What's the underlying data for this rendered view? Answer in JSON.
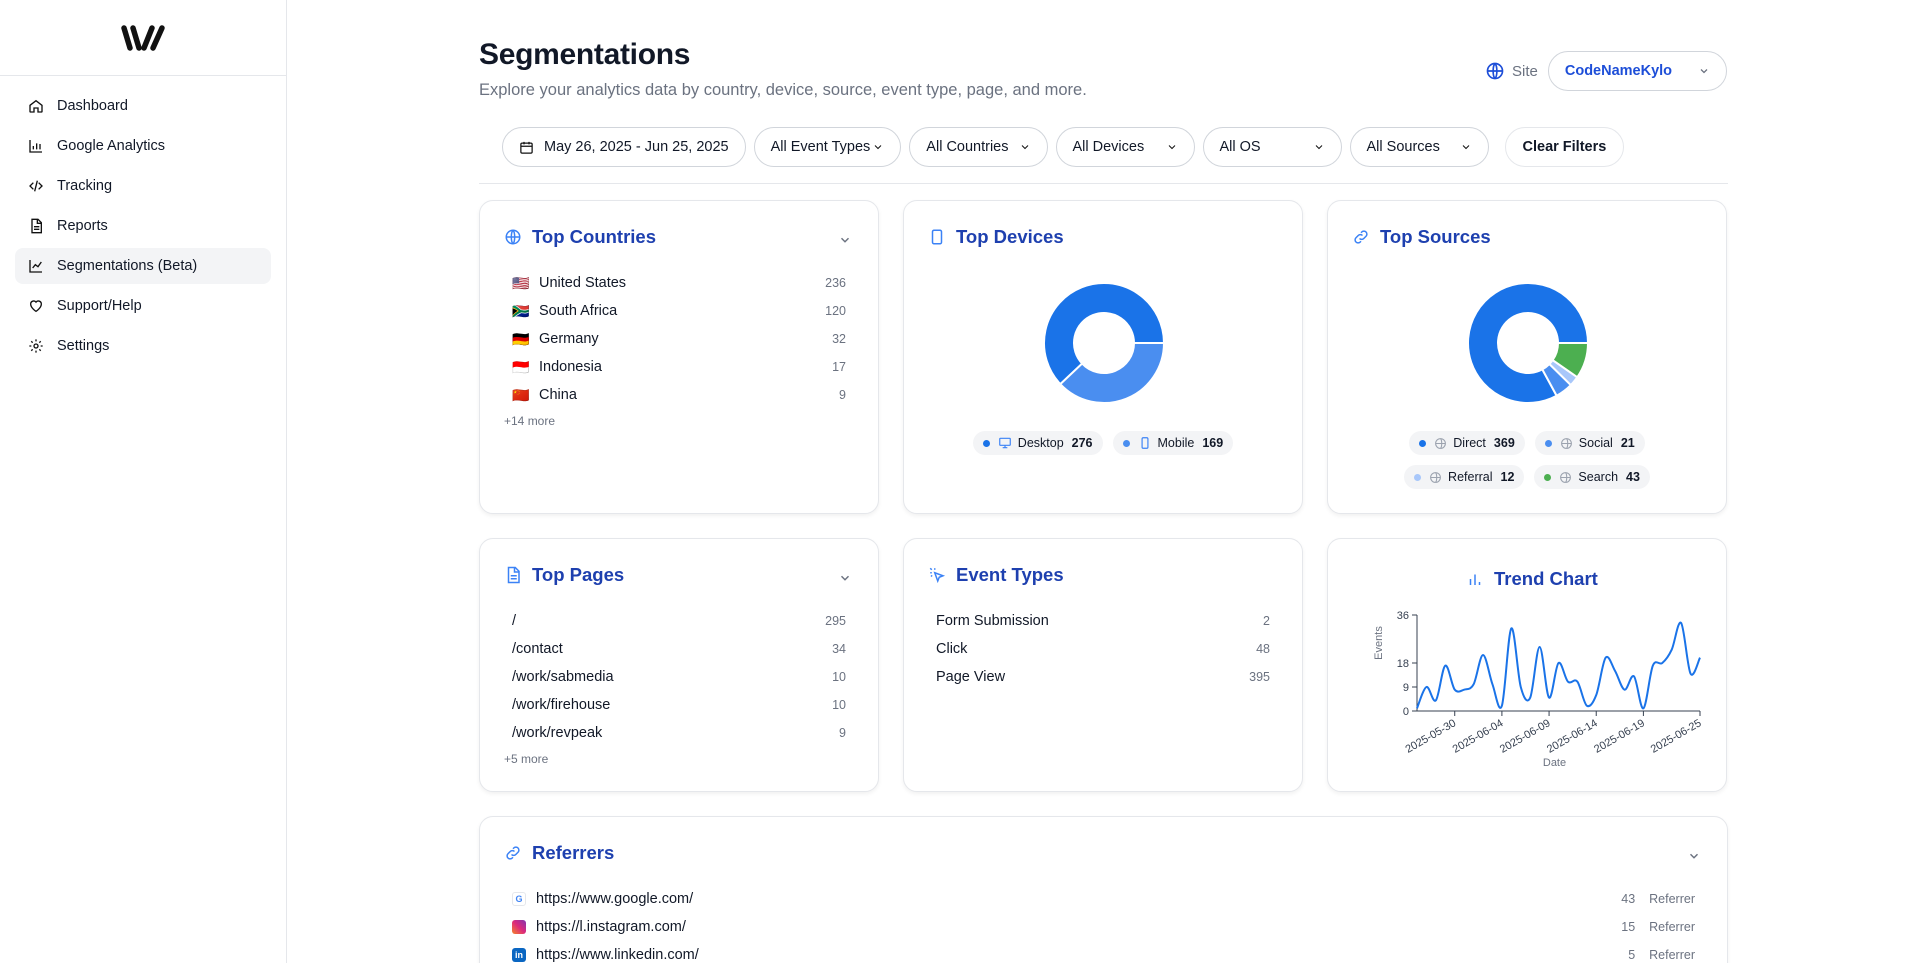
{
  "sidebar": {
    "items": [
      {
        "label": "Dashboard",
        "icon": "home-icon"
      },
      {
        "label": "Google Analytics",
        "icon": "bar-chart-icon"
      },
      {
        "label": "Tracking",
        "icon": "code-icon"
      },
      {
        "label": "Reports",
        "icon": "document-icon"
      },
      {
        "label": "Segmentations (Beta)",
        "icon": "line-chart-icon",
        "active": true
      },
      {
        "label": "Support/Help",
        "icon": "heart-icon"
      },
      {
        "label": "Settings",
        "icon": "gear-icon"
      }
    ]
  },
  "header": {
    "title": "Segmentations",
    "subtitle": "Explore your analytics data by country, device, source, event type, page, and more.",
    "site_label": "Site",
    "site_value": "CodeNameKylo"
  },
  "filters": {
    "date_range": "May 26, 2025 - Jun 25, 2025",
    "event_types": "All Event Types",
    "countries": "All Countries",
    "devices": "All Devices",
    "os": "All OS",
    "sources": "All Sources",
    "clear": "Clear Filters"
  },
  "top_countries": {
    "title": "Top Countries",
    "rows": [
      {
        "flag": "🇺🇸",
        "name": "United States",
        "count": "236"
      },
      {
        "flag": "🇿🇦",
        "name": "South Africa",
        "count": "120"
      },
      {
        "flag": "🇩🇪",
        "name": "Germany",
        "count": "32"
      },
      {
        "flag": "🇮🇩",
        "name": "Indonesia",
        "count": "17"
      },
      {
        "flag": "🇨🇳",
        "name": "China",
        "count": "9"
      }
    ],
    "more": "+14 more"
  },
  "top_devices": {
    "title": "Top Devices",
    "items": [
      {
        "label": "Desktop",
        "value": "276",
        "color": "#1a73e8"
      },
      {
        "label": "Mobile",
        "value": "169",
        "color": "#4a8ef0"
      }
    ]
  },
  "top_sources": {
    "title": "Top Sources",
    "items": [
      {
        "label": "Direct",
        "value": "369",
        "color": "#1a73e8"
      },
      {
        "label": "Social",
        "value": "21",
        "color": "#4a8ef0"
      },
      {
        "label": "Referral",
        "value": "12",
        "color": "#a8c7fa"
      },
      {
        "label": "Search",
        "value": "43",
        "color": "#4caf50"
      }
    ]
  },
  "top_pages": {
    "title": "Top Pages",
    "rows": [
      {
        "path": "/",
        "count": "295"
      },
      {
        "path": "/contact",
        "count": "34"
      },
      {
        "path": "/work/sabmedia",
        "count": "10"
      },
      {
        "path": "/work/firehouse",
        "count": "10"
      },
      {
        "path": "/work/revpeak",
        "count": "9"
      }
    ],
    "more": "+5 more"
  },
  "event_types": {
    "title": "Event Types",
    "rows": [
      {
        "name": "Form Submission",
        "count": "2"
      },
      {
        "name": "Click",
        "count": "48"
      },
      {
        "name": "Page View",
        "count": "395"
      }
    ]
  },
  "trend": {
    "title": "Trend Chart"
  },
  "chart_data": {
    "type": "line",
    "title": "",
    "xlabel": "Date",
    "ylabel": "Events",
    "ylim": [
      0,
      36
    ],
    "yticks": [
      "0",
      "9",
      "18",
      "36"
    ],
    "xticks": [
      "2025-05-30",
      "2025-06-04",
      "2025-06-09",
      "2025-06-14",
      "2025-06-19",
      "2025-06-25"
    ],
    "x": [
      "2025-05-26",
      "2025-05-27",
      "2025-05-28",
      "2025-05-29",
      "2025-05-30",
      "2025-05-31",
      "2025-06-01",
      "2025-06-02",
      "2025-06-03",
      "2025-06-04",
      "2025-06-05",
      "2025-06-06",
      "2025-06-07",
      "2025-06-08",
      "2025-06-09",
      "2025-06-10",
      "2025-06-11",
      "2025-06-12",
      "2025-06-13",
      "2025-06-14",
      "2025-06-15",
      "2025-06-16",
      "2025-06-17",
      "2025-06-18",
      "2025-06-19",
      "2025-06-20",
      "2025-06-21",
      "2025-06-22",
      "2025-06-23",
      "2025-06-24",
      "2025-06-25"
    ],
    "series": [
      {
        "values": [
          1,
          9,
          4,
          17,
          8,
          8,
          10,
          21,
          10,
          2,
          31,
          9,
          5,
          24,
          5,
          18,
          11,
          11,
          2,
          6,
          20,
          15,
          8,
          13,
          1,
          17,
          18,
          23,
          33,
          14,
          20
        ]
      }
    ]
  },
  "referrers": {
    "title": "Referrers",
    "rows": [
      {
        "url": "https://www.google.com/",
        "count": "43",
        "type": "Referrer",
        "icon": "google-icon"
      },
      {
        "url": "https://l.instagram.com/",
        "count": "15",
        "type": "Referrer",
        "icon": "instagram-icon"
      },
      {
        "url": "https://www.linkedin.com/",
        "count": "5",
        "type": "Referrer",
        "icon": "linkedin-icon"
      }
    ]
  }
}
